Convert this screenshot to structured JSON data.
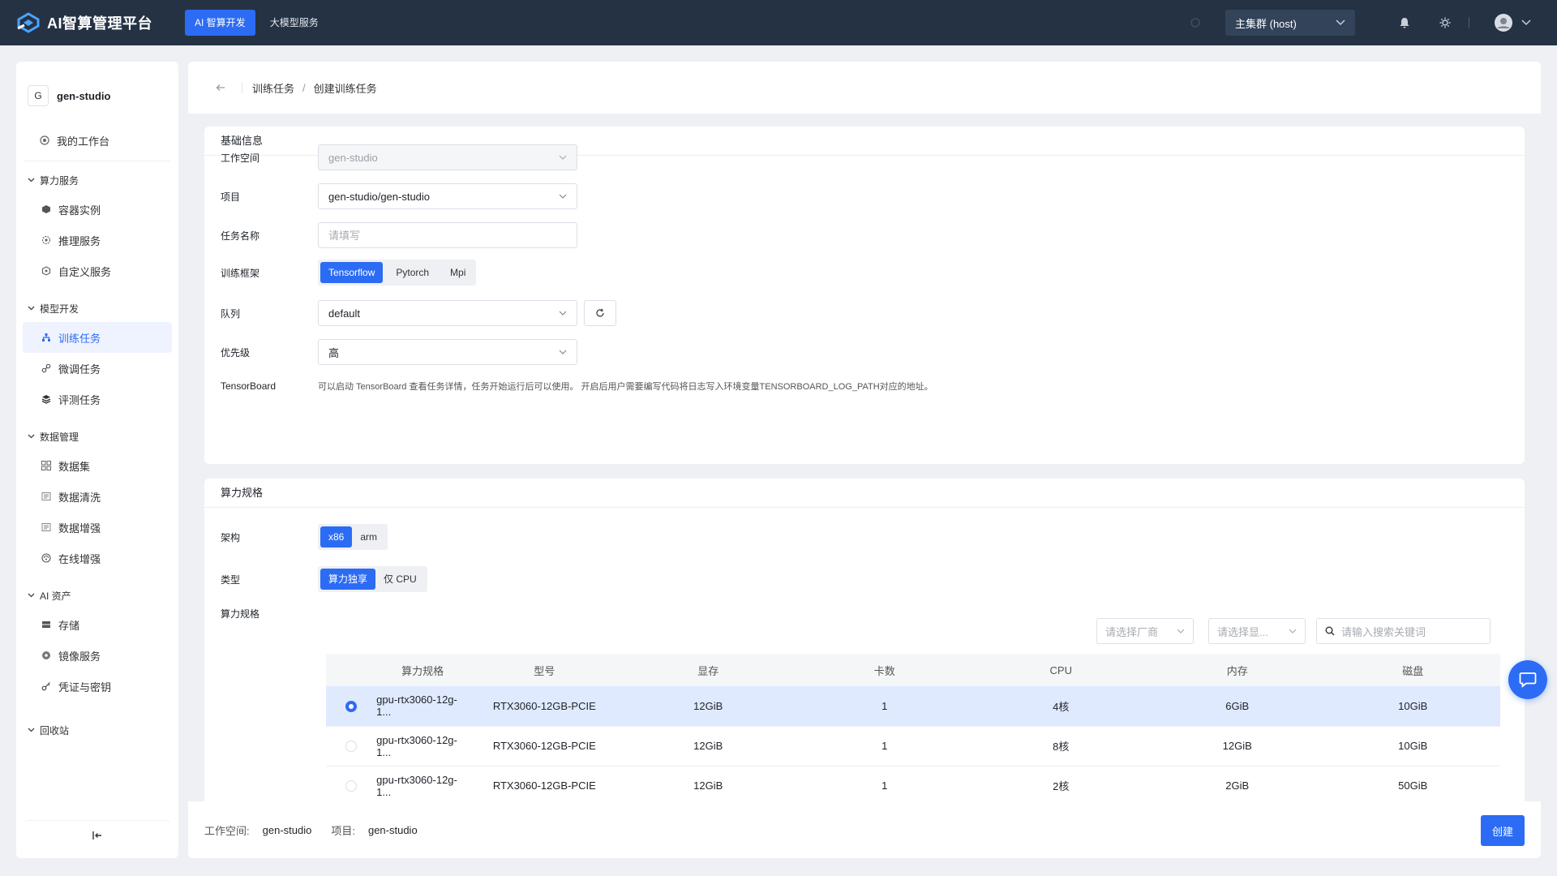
{
  "app": {
    "title": "AI智算管理平台",
    "tabs": [
      {
        "label": "AI 智算开发",
        "active": true
      },
      {
        "label": "大模型服务",
        "active": false
      }
    ],
    "cluster": "主集群 (host)"
  },
  "sidebar": {
    "workspace_initial": "G",
    "workspace": "gen-studio",
    "home": "我的工作台",
    "groups": [
      {
        "label": "算力服务",
        "items": [
          "容器实例",
          "推理服务",
          "自定义服务"
        ]
      },
      {
        "label": "模型开发",
        "items": [
          "训练任务",
          "微调任务",
          "评测任务"
        ]
      },
      {
        "label": "数据管理",
        "items": [
          "数据集",
          "数据清洗",
          "数据增强",
          "在线增强"
        ]
      },
      {
        "label": "AI 资产",
        "items": [
          "存储",
          "镜像服务",
          "凭证与密钥"
        ]
      },
      {
        "label": "回收站",
        "items": []
      }
    ],
    "active_item": "训练任务"
  },
  "breadcrumb": {
    "parent": "训练任务",
    "sep": "/",
    "current": "创建训练任务"
  },
  "basic": {
    "title": "基础信息",
    "workspace_label": "工作空间",
    "workspace_value": "gen-studio",
    "project_label": "项目",
    "project_value": "gen-studio/gen-studio",
    "taskname_label": "任务名称",
    "taskname_placeholder": "请填写",
    "framework_label": "训练框架",
    "frameworks": [
      "Tensorflow",
      "Pytorch",
      "Mpi"
    ],
    "framework_selected": "Tensorflow",
    "queue_label": "队列",
    "queue_value": "default",
    "priority_label": "优先级",
    "priority_value": "高",
    "tb_label": "TensorBoard",
    "tb_desc": "可以启动 TensorBoard 查看任务详情，任务开始运行后可以使用。 开启后用户需要编写代码将日志写入环境变量TENSORBOARD_LOG_PATH对应的地址。"
  },
  "compute": {
    "title": "算力规格",
    "arch_label": "架构",
    "archs": [
      "x86",
      "arm"
    ],
    "arch_selected": "x86",
    "type_label": "类型",
    "types": [
      "算力独享",
      "仅 CPU"
    ],
    "type_selected": "算力独享",
    "spec_label": "算力规格",
    "vendor_placeholder": "请选择厂商",
    "gpu_placeholder": "请选择显...",
    "search_placeholder": "请输入搜索关键词",
    "columns": [
      "算力规格",
      "型号",
      "显存",
      "卡数",
      "CPU",
      "内存",
      "磁盘"
    ],
    "rows": [
      {
        "selected": true,
        "spec": "gpu-rtx3060-12g-1...",
        "model": "RTX3060-12GB-PCIE",
        "vram": "12GiB",
        "cards": "1",
        "cpu": "4核",
        "mem": "6GiB",
        "disk": "10GiB"
      },
      {
        "selected": false,
        "spec": "gpu-rtx3060-12g-1...",
        "model": "RTX3060-12GB-PCIE",
        "vram": "12GiB",
        "cards": "1",
        "cpu": "8核",
        "mem": "12GiB",
        "disk": "10GiB"
      },
      {
        "selected": false,
        "spec": "gpu-rtx3060-12g-1...",
        "model": "RTX3060-12GB-PCIE",
        "vram": "12GiB",
        "cards": "1",
        "cpu": "2核",
        "mem": "2GiB",
        "disk": "50GiB"
      }
    ]
  },
  "footer": {
    "workspace_label": "工作空间:",
    "workspace_value": "gen-studio",
    "project_label": "项目:",
    "project_value": "gen-studio",
    "create_label": "创建"
  },
  "colors": {
    "primary": "#2c6cf4",
    "topbar": "#243244"
  }
}
